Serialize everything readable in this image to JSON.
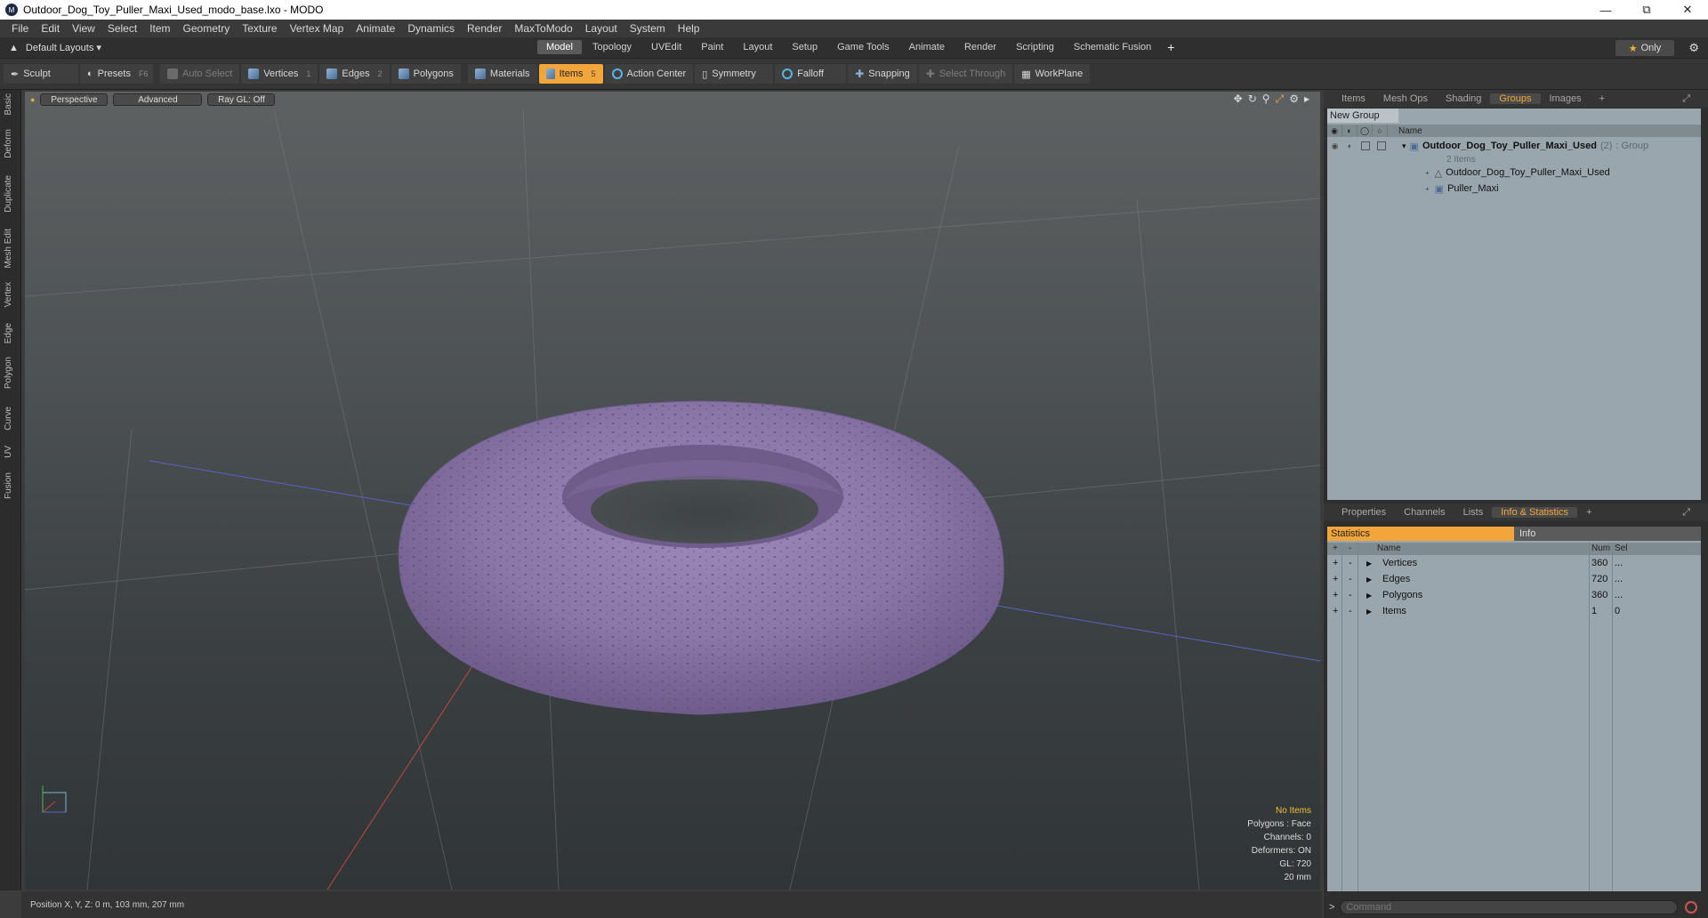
{
  "window": {
    "title": "Outdoor_Dog_Toy_Puller_Maxi_Used_modo_base.lxo - MODO"
  },
  "menu": [
    "File",
    "Edit",
    "View",
    "Select",
    "Item",
    "Geometry",
    "Texture",
    "Vertex Map",
    "Animate",
    "Dynamics",
    "Render",
    "MaxToModo",
    "Layout",
    "System",
    "Help"
  ],
  "layout": {
    "selector": "Default Layouts ▾",
    "tabs": [
      "Model",
      "Topology",
      "UVEdit",
      "Paint",
      "Layout",
      "Setup",
      "Game Tools",
      "Animate",
      "Render",
      "Scripting",
      "Schematic Fusion"
    ],
    "active_tab": "Model",
    "only_label": "Only"
  },
  "toolbar": {
    "sculpt": "Sculpt",
    "presets": "Presets",
    "presets_key": "F6",
    "auto_select": "Auto Select",
    "vertices": "Vertices",
    "vertices_key": "1",
    "edges": "Edges",
    "edges_key": "2",
    "polygons": "Polygons",
    "materials": "Materials",
    "items": "Items",
    "items_key": "5",
    "action_center": "Action Center",
    "symmetry": "Symmetry",
    "falloff": "Falloff",
    "snapping": "Snapping",
    "select_through": "Select Through",
    "workplane": "WorkPlane"
  },
  "left_tabs": [
    "Basic",
    "Deform",
    "Duplicate",
    "Mesh Edit",
    "Vertex",
    "Edge",
    "Polygon",
    "Curve",
    "UV",
    "Fusion"
  ],
  "viewport": {
    "view": "Perspective",
    "shading": "Advanced",
    "raygl": "Ray GL: Off",
    "info": {
      "no_items": "No Items",
      "polygons": "Polygons : Face",
      "channels": "Channels: 0",
      "deformers": "Deformers: ON",
      "gl": "GL: 720",
      "scale": "20 mm"
    },
    "torus_color": "#8a76a8"
  },
  "status": {
    "position": "Position X, Y, Z:   0 m, 103 mm, 207 mm"
  },
  "groups_panel": {
    "tabs": [
      "Items",
      "Mesh Ops",
      "Shading",
      "Groups",
      "Images"
    ],
    "active_tab": "Groups",
    "new_group": "New Group",
    "name_col": "Name",
    "group_name": "Outdoor_Dog_Toy_Puller_Maxi_Used",
    "group_count": "(2)",
    "group_type": ": Group",
    "group_items": "2 Items",
    "children": [
      "Outdoor_Dog_Toy_Puller_Maxi_Used",
      "Puller_Maxi"
    ]
  },
  "info_panel": {
    "tabs": [
      "Properties",
      "Channels",
      "Lists",
      "Info & Statistics"
    ],
    "active_tab": "Info & Statistics",
    "statistics": "Statistics",
    "info": "Info",
    "col_name": "Name",
    "col_num": "Num",
    "col_sel": "Sel",
    "rows": [
      {
        "name": "Vertices",
        "num": "360",
        "sel": "..."
      },
      {
        "name": "Edges",
        "num": "720",
        "sel": "..."
      },
      {
        "name": "Polygons",
        "num": "360",
        "sel": "..."
      },
      {
        "name": "Items",
        "num": "1",
        "sel": "0"
      }
    ]
  },
  "command": {
    "prompt": ">",
    "placeholder": "Command"
  },
  "accent_color": "#f2a53a"
}
